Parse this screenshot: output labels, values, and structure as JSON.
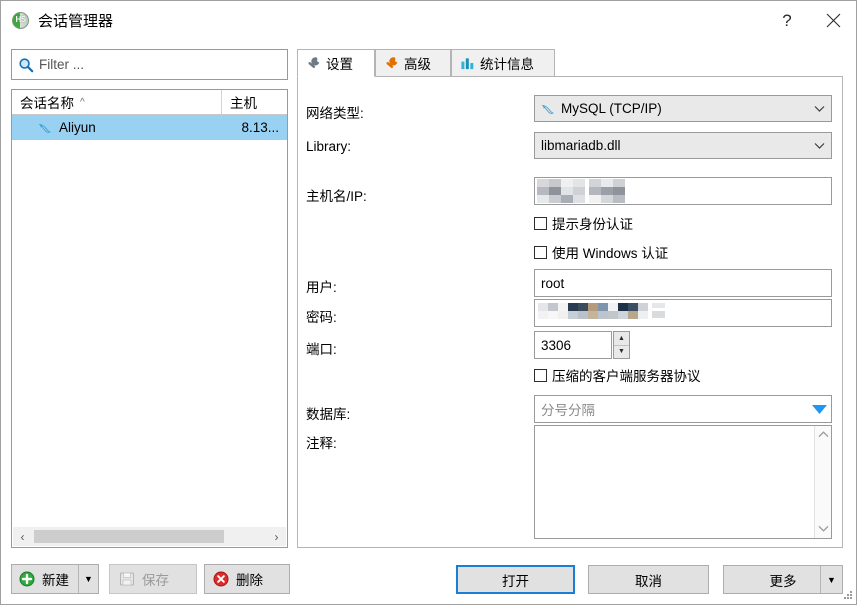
{
  "window": {
    "title": "会话管理器",
    "icon": "heidisql-logo-icon",
    "logo_text": "HS",
    "help_label": "?",
    "close_label": "×"
  },
  "sidebar": {
    "filter": {
      "placeholder": "Filter ...",
      "value": "",
      "icon": "search-icon"
    },
    "tree": {
      "columns": [
        {
          "label": "会话名称",
          "sort": "^"
        },
        {
          "label": "主机"
        }
      ],
      "rows": [
        {
          "name": "Aliyun",
          "host": "8.13...",
          "icon": "mysql-dolphin-icon",
          "selected": true
        }
      ]
    },
    "scrollbar": {
      "left_arrow": "‹",
      "right_arrow": "›"
    },
    "buttons": {
      "new": {
        "label": "新建",
        "icon": "plus-circle-green-icon",
        "dropdown": "▼",
        "enabled": true
      },
      "save": {
        "label": "保存",
        "icon": "floppy-disk-icon",
        "enabled": false
      },
      "delete": {
        "label": "删除",
        "icon": "delete-circle-red-icon",
        "enabled": true
      }
    }
  },
  "tabs": [
    {
      "label": "设置",
      "icon": "wrench-gray-icon",
      "active": true
    },
    {
      "label": "高级",
      "icon": "wrench-orange-icon",
      "active": false
    },
    {
      "label": "统计信息",
      "icon": "bar-chart-icon",
      "active": false
    }
  ],
  "settings": {
    "network_type": {
      "label": "网络类型:",
      "value": "MySQL (TCP/IP)",
      "icon": "mysql-dolphin-icon"
    },
    "library": {
      "label": "Library:",
      "value": "libmariadb.dll"
    },
    "hostname": {
      "label": "主机名/IP:",
      "value": "",
      "redacted": true
    },
    "prompt_credentials": {
      "label": "提示身份认证",
      "checked": false
    },
    "windows_auth": {
      "label": "使用 Windows 认证",
      "checked": false
    },
    "user": {
      "label": "用户:",
      "value": "root"
    },
    "password": {
      "label": "密码:",
      "value": "",
      "redacted": true
    },
    "port": {
      "label": "端口:",
      "value": "3306",
      "spinner_up": "▲",
      "spinner_down": "▼"
    },
    "compressed_protocol": {
      "label": "压缩的客户端服务器协议",
      "checked": false
    },
    "databases": {
      "label": "数据库:",
      "value": "",
      "placeholder": "分号分隔",
      "arrow": "▼"
    },
    "comment": {
      "label": "注释:",
      "value": "",
      "scroll_up": "⌃",
      "scroll_down": "⌄"
    }
  },
  "footer": {
    "open": {
      "label": "打开",
      "focused": true
    },
    "cancel": {
      "label": "取消"
    },
    "more": {
      "label": "更多",
      "dropdown": "▼"
    }
  },
  "colors": {
    "selection_blue": "#99d1f2",
    "focus_blue": "#1a7fd4",
    "dropdown_arrow_blue": "#2196f3",
    "accent_green": "#3fa93f",
    "accent_red": "#e02b2b",
    "accent_orange": "#e07000"
  }
}
